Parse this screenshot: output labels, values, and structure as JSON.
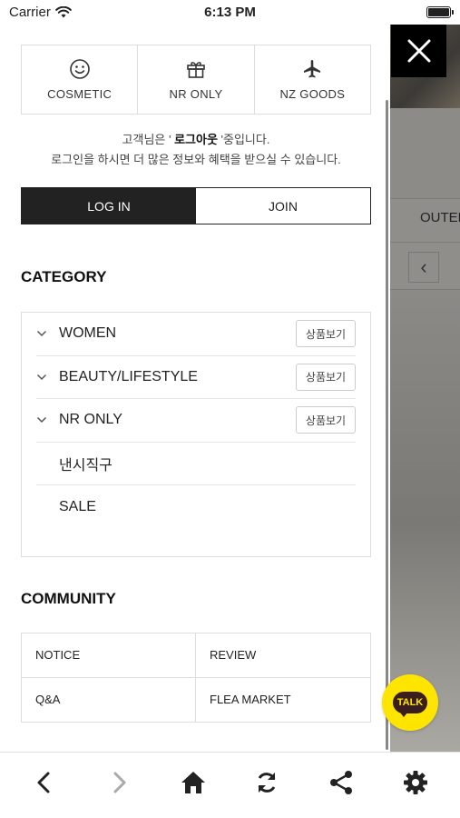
{
  "status_bar": {
    "carrier": "Carrier",
    "time": "6:13 PM"
  },
  "background_page": {
    "menu_partial": "OUTER"
  },
  "quick_links": [
    {
      "label": "COSMETIC",
      "icon": "smiley-icon"
    },
    {
      "label": "NR ONLY",
      "icon": "gift-icon"
    },
    {
      "label": "NZ GOODS",
      "icon": "airplane-icon"
    }
  ],
  "login_message": {
    "prefix": "고객님은 ' ",
    "status": "로그아웃",
    "suffix": " '중입니다.",
    "line2": "로그인을 하시면 더 많은 정보와 혜택을 받으실 수 있습니다."
  },
  "auth": {
    "login_label": "LOG IN",
    "join_label": "JOIN"
  },
  "category": {
    "title": "CATEGORY",
    "items": [
      {
        "label": "WOMEN",
        "expandable": true,
        "button": "상품보기"
      },
      {
        "label": "BEAUTY/LIFESTYLE",
        "expandable": true,
        "button": "상품보기"
      },
      {
        "label": "NR ONLY",
        "expandable": true,
        "button": "상품보기"
      },
      {
        "label": "낸시직구",
        "expandable": false,
        "button": ""
      },
      {
        "label": "SALE",
        "expandable": false,
        "button": ""
      }
    ]
  },
  "community": {
    "title": "COMMUNITY",
    "items": [
      "NOTICE",
      "REVIEW",
      "Q&A",
      "FLEA MARKET"
    ]
  },
  "talk_button": {
    "label": "TALK",
    "color": "#fee500"
  },
  "colors": {
    "dark": "#222222",
    "border": "#dddddd",
    "talk_yellow": "#fee500"
  },
  "toolbar": [
    "back-icon",
    "forward-icon",
    "home-icon",
    "refresh-icon",
    "share-icon",
    "settings-icon"
  ]
}
